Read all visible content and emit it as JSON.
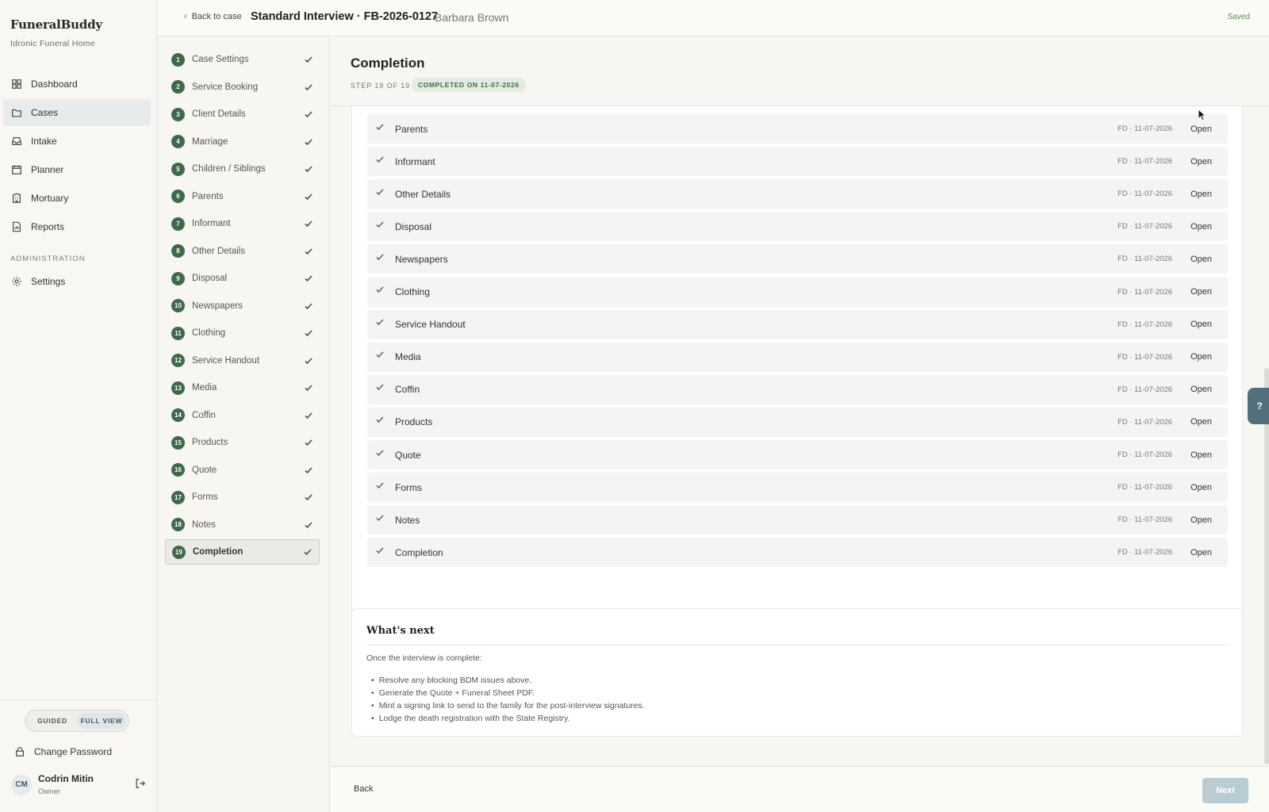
{
  "brand": {
    "name": "FuneralBuddy",
    "subtitle": "Idronic Funeral Home"
  },
  "nav": [
    {
      "label": "Dashboard",
      "icon": "dashboard-icon"
    },
    {
      "label": "Cases",
      "icon": "folder-icon",
      "active": true
    },
    {
      "label": "Intake",
      "icon": "inbox-icon"
    },
    {
      "label": "Planner",
      "icon": "calendar-icon"
    },
    {
      "label": "Mortuary",
      "icon": "building-icon"
    },
    {
      "label": "Reports",
      "icon": "report-icon"
    }
  ],
  "admin": {
    "heading": "ADMINISTRATION",
    "settings_label": "Settings"
  },
  "view_toggle": {
    "guided": "GUIDED",
    "full": "FULL VIEW",
    "selected": "FULL VIEW"
  },
  "account": {
    "change_password": "Change Password",
    "initials": "CM",
    "name": "Codrin Mitin",
    "role": "Owner"
  },
  "header": {
    "back_label": "Back to case",
    "title": "Standard Interview · FB-2026-0127",
    "client": "Barbara Brown",
    "status": "Saved"
  },
  "steps": [
    {
      "num": "1",
      "label": "Case Settings"
    },
    {
      "num": "2",
      "label": "Service Booking"
    },
    {
      "num": "3",
      "label": "Client Details"
    },
    {
      "num": "4",
      "label": "Marriage"
    },
    {
      "num": "5",
      "label": "Children / Siblings"
    },
    {
      "num": "6",
      "label": "Parents"
    },
    {
      "num": "7",
      "label": "Informant"
    },
    {
      "num": "8",
      "label": "Other Details"
    },
    {
      "num": "9",
      "label": "Disposal"
    },
    {
      "num": "10",
      "label": "Newspapers"
    },
    {
      "num": "11",
      "label": "Clothing"
    },
    {
      "num": "12",
      "label": "Service Handout"
    },
    {
      "num": "13",
      "label": "Media"
    },
    {
      "num": "14",
      "label": "Coffin"
    },
    {
      "num": "15",
      "label": "Products"
    },
    {
      "num": "16",
      "label": "Quote"
    },
    {
      "num": "17",
      "label": "Forms"
    },
    {
      "num": "18",
      "label": "Notes"
    },
    {
      "num": "19",
      "label": "Completion",
      "active": true
    }
  ],
  "main": {
    "title": "Completion",
    "step_of": "STEP 19 OF 19",
    "badge": "COMPLETED ON 11-07-2026",
    "rows": [
      {
        "label": "Parents",
        "meta": "FD · 11-07-2026",
        "action": "Open"
      },
      {
        "label": "Informant",
        "meta": "FD · 11-07-2026",
        "action": "Open"
      },
      {
        "label": "Other Details",
        "meta": "FD · 11-07-2026",
        "action": "Open"
      },
      {
        "label": "Disposal",
        "meta": "FD · 11-07-2026",
        "action": "Open"
      },
      {
        "label": "Newspapers",
        "meta": "FD · 11-07-2026",
        "action": "Open"
      },
      {
        "label": "Clothing",
        "meta": "FD · 11-07-2026",
        "action": "Open"
      },
      {
        "label": "Service Handout",
        "meta": "FD · 11-07-2026",
        "action": "Open"
      },
      {
        "label": "Media",
        "meta": "FD · 11-07-2026",
        "action": "Open"
      },
      {
        "label": "Coffin",
        "meta": "FD · 11-07-2026",
        "action": "Open"
      },
      {
        "label": "Products",
        "meta": "FD · 11-07-2026",
        "action": "Open"
      },
      {
        "label": "Quote",
        "meta": "FD · 11-07-2026",
        "action": "Open"
      },
      {
        "label": "Forms",
        "meta": "FD · 11-07-2026",
        "action": "Open"
      },
      {
        "label": "Notes",
        "meta": "FD · 11-07-2026",
        "action": "Open"
      },
      {
        "label": "Completion",
        "meta": "FD · 11-07-2026",
        "action": "Open"
      }
    ],
    "whats_next": {
      "title": "What's next",
      "intro": "Once the interview is complete:",
      "items": [
        "Resolve any blocking BDM issues above.",
        "Generate the Quote + Funeral Sheet PDF.",
        "Mint a signing link to send to the family for the post-interview signatures.",
        "Lodge the death registration with the State Registry."
      ]
    }
  },
  "footer": {
    "back_label": "Back",
    "next_label": "Next"
  },
  "help": {
    "label": "?"
  },
  "colors": {
    "accent_green": "#3f6a49",
    "accent_blue": "#52707c",
    "next_disabled": "#b9cbd3"
  }
}
